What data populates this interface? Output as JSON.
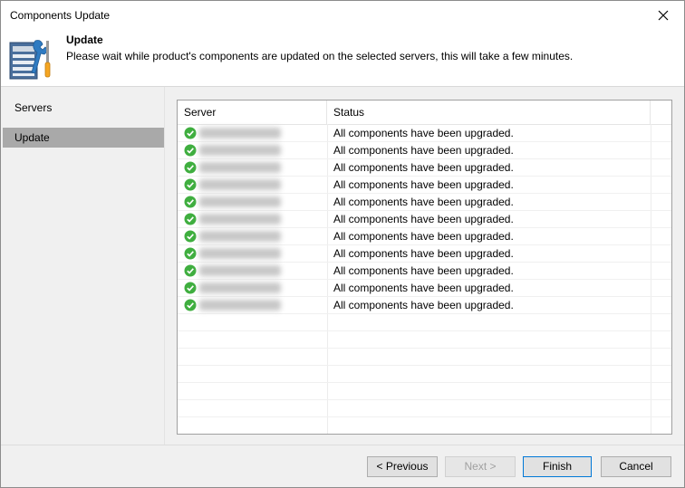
{
  "window": {
    "title": "Components Update"
  },
  "header": {
    "title": "Update",
    "description": "Please wait while product's components are updated on the selected servers, this will take a few minutes.",
    "icon": "server-tools-icon"
  },
  "sidebar": {
    "items": [
      {
        "label": "Servers",
        "active": false
      },
      {
        "label": "Update",
        "active": true
      }
    ]
  },
  "table": {
    "columns": [
      "Server",
      "Status"
    ],
    "rows": [
      {
        "server": "",
        "status": "All components have been upgraded."
      },
      {
        "server": "",
        "status": "All components have been upgraded."
      },
      {
        "server": "",
        "status": "All components have been upgraded."
      },
      {
        "server": "",
        "status": "All components have been upgraded."
      },
      {
        "server": "",
        "status": "All components have been upgraded."
      },
      {
        "server": "",
        "status": "All components have been upgraded."
      },
      {
        "server": "",
        "status": "All components have been upgraded."
      },
      {
        "server": "",
        "status": "All components have been upgraded."
      },
      {
        "server": "",
        "status": "All components have been upgraded."
      },
      {
        "server": "",
        "status": "All components have been upgraded."
      },
      {
        "server": "",
        "status": "All components have been upgraded."
      }
    ],
    "status_color": "#3fae3f"
  },
  "buttons": {
    "previous": "< Previous",
    "next": "Next >",
    "finish": "Finish",
    "cancel": "Cancel"
  }
}
